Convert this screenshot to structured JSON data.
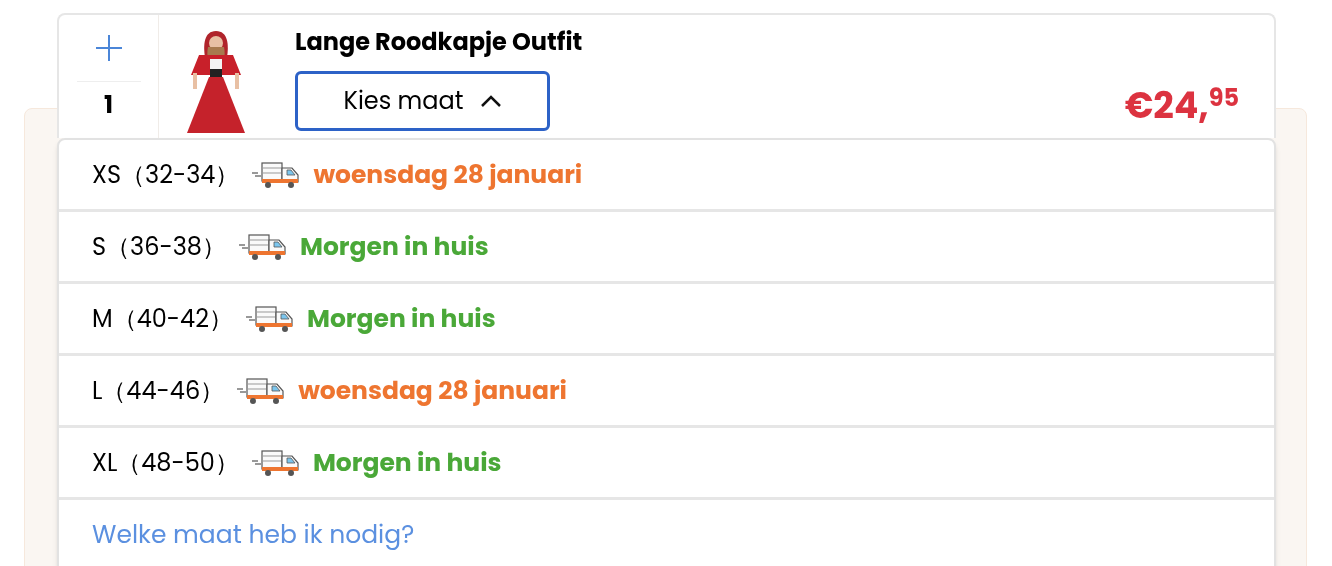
{
  "product": {
    "title": "Lange Roodkapje Outfit",
    "quantity": "1",
    "price": "€24,$^{95}$"
  },
  "size_select": {
    "label": "Kies maat",
    "expanded": true,
    "options": [
      {
        "size": "XS（32-34）",
        "delivery": "woensdag 28 januari",
        "color": "#ee7530"
      },
      {
        "size": "S（36-38）",
        "delivery": "Morgen in huis",
        "color": "#4aa838"
      },
      {
        "size": "M（40-42）",
        "delivery": "Morgen in huis",
        "color": "#4aa838"
      },
      {
        "size": "L（44-46）",
        "delivery": "woensdag 28 januari",
        "color": "#ee7530"
      },
      {
        "size": "XL（48-50）",
        "delivery": "Morgen in huis",
        "color": "#4aa838"
      }
    ],
    "help_link": "Welke maat heb ik nodig?"
  }
}
